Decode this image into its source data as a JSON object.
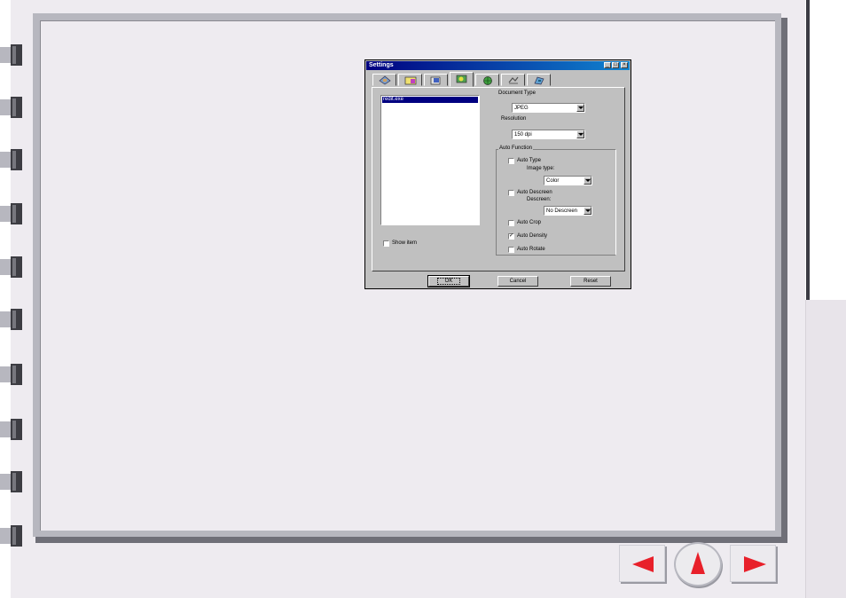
{
  "dialog": {
    "title": "Settings",
    "tabs": [
      {
        "icon": "scanner-tab-icon",
        "active": false
      },
      {
        "icon": "color-tab-icon",
        "active": false
      },
      {
        "icon": "image-tab-icon",
        "active": false
      },
      {
        "icon": "settings-tab-icon",
        "active": true
      },
      {
        "icon": "globe-tab-icon",
        "active": false
      },
      {
        "icon": "tools-tab-icon",
        "active": false
      },
      {
        "icon": "scan-tab-icon",
        "active": false
      }
    ],
    "list_items": [
      "redit.exe"
    ],
    "show_item_label": "Show item",
    "document_type": {
      "label": "Document Type",
      "value": "JPEG"
    },
    "resolution": {
      "label": "Resolution",
      "value": "150 dpi"
    },
    "auto_function": {
      "legend": "Auto Function",
      "auto_type": {
        "label": "Auto Type",
        "checked": false
      },
      "image_type": {
        "label": "Image type:",
        "value": "Color"
      },
      "auto_descreen": {
        "label": "Auto Descreen",
        "checked": false
      },
      "descreen": {
        "label": "Descreen:",
        "value": "No Descreen"
      },
      "auto_crop": {
        "label": "Auto Crop",
        "checked": false
      },
      "auto_density": {
        "label": "Auto Density",
        "checked": true
      },
      "auto_rotate": {
        "label": "Auto Rotate",
        "checked": false
      }
    },
    "buttons": {
      "ok": "OK",
      "cancel": "Cancel",
      "reset": "Reset"
    }
  },
  "nav": {
    "prev_icon": "left-arrow-icon",
    "home_icon": "up-arrow-icon",
    "next_icon": "right-arrow-icon",
    "arrow_color": "#e8202a"
  },
  "colors": {
    "backdrop": "#eeebf0",
    "titlebar": "#000080",
    "dialog_face": "#c0c0c0"
  }
}
